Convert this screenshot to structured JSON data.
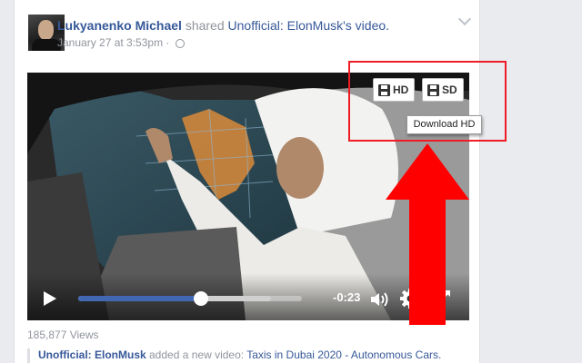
{
  "post": {
    "author": "Lukyanenko Michael",
    "action_text": " shared ",
    "source_link": "Unofficial: ElonMusk",
    "source_suffix": "'s video.",
    "timestamp": "January 27 at 3:53pm · ",
    "privacy_icon": "globe-icon",
    "options_icon": "chevron-down-icon"
  },
  "video": {
    "progress_fraction": 0.55,
    "buffered_fraction": 0.86,
    "time_remaining": "-0:23",
    "icons": [
      "play-icon",
      "speaker-icon",
      "gear-icon",
      "fullscreen-icon"
    ],
    "download_buttons": {
      "hd_label": "HD",
      "sd_label": "SD",
      "icon": "floppy-icon"
    },
    "tooltip": "Download HD"
  },
  "stats": {
    "views": "185,877 Views"
  },
  "shared_post": {
    "author": "Unofficial: ElonMusk",
    "action_text": " added a new video: ",
    "title": "Taxis in Dubai 2020 - Autonomous Cars."
  },
  "colors": {
    "page_bg": "#e9ebee",
    "link": "#365899",
    "meta_text": "#90949c",
    "progress_fill": "#4267b2",
    "annotation_red": "#ee1c24"
  }
}
